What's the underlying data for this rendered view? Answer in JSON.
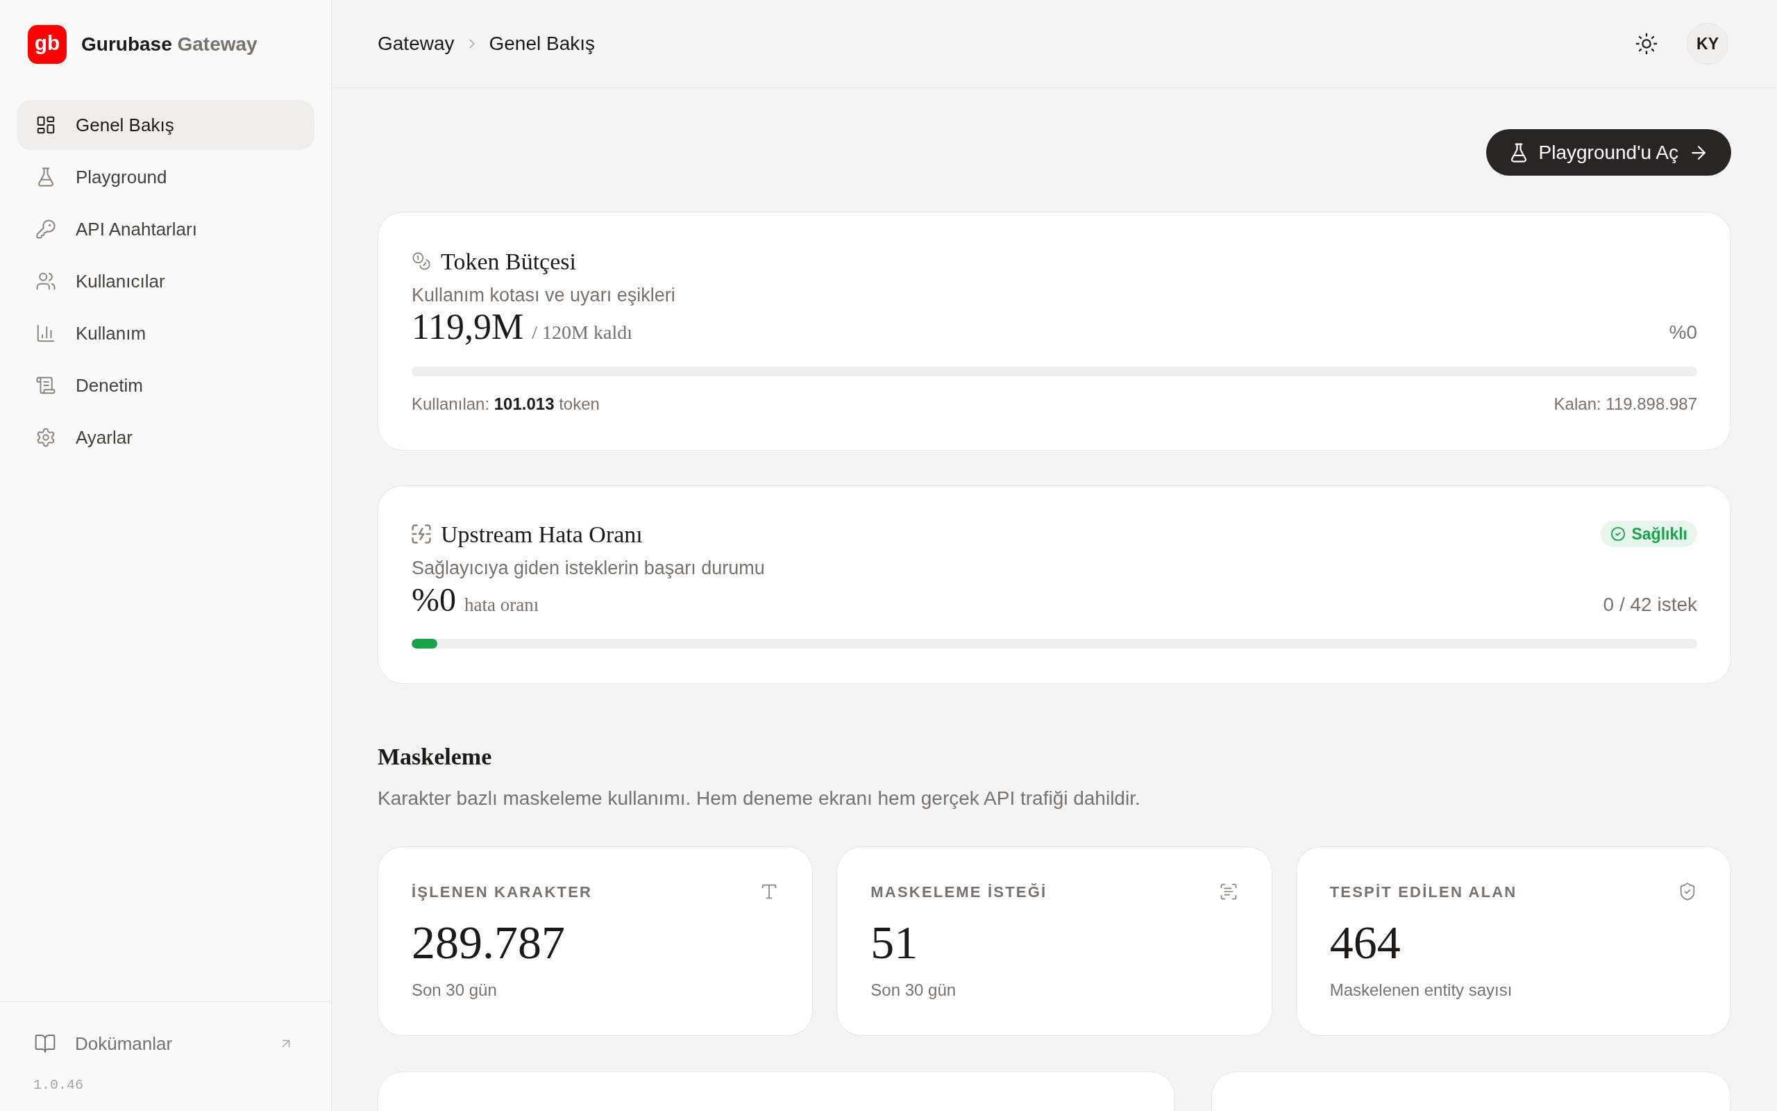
{
  "sidebar": {
    "logo": {
      "mark": "gb",
      "name": "Gurubase",
      "suffix": "Gateway"
    },
    "items": [
      {
        "label": "Genel Bakış",
        "selected": true
      },
      {
        "label": "Playground",
        "selected": false
      },
      {
        "label": "API Anahtarları",
        "selected": false
      },
      {
        "label": "Kullanıcılar",
        "selected": false
      },
      {
        "label": "Kullanım",
        "selected": false
      },
      {
        "label": "Denetim",
        "selected": false
      },
      {
        "label": "Ayarlar",
        "selected": false
      }
    ],
    "docs_link": "Dokümanlar",
    "version": "1.0.46"
  },
  "header": {
    "breadcrumb": [
      "Gateway",
      "Genel Bakış"
    ],
    "avatar": "KY"
  },
  "playground_button": "Playground'u Aç",
  "token_budget": {
    "title": "Token Bütçesi",
    "subtitle": "Kullanım kotası ve uyarı eşikleri",
    "value": "119,9M",
    "value_note": "/ 120M kaldı",
    "percent": "%0",
    "used": "Kullanılan: **101.013** token",
    "remaining": "Kalan: 119.898.987"
  },
  "upstream": {
    "title": "Upstream Hata Oranı",
    "status": {
      "label": "Sağlıklı",
      "kind": "healthy"
    },
    "subtitle": "Sağlayıcıya giden isteklerin başarı durumu",
    "value": "%0",
    "value_note": "hata oranı",
    "requests": "0 / 42 istek",
    "level": 0.02
  },
  "masking": {
    "title": "Maskeleme",
    "description": "Karakter bazlı maskeleme kullanımı. Hem deneme ekranı hem gerçek API trafiği dahildir.",
    "stats": [
      {
        "label": "İŞLENEN KARAKTER",
        "value": "289.787",
        "note": "Son 30 gün"
      },
      {
        "label": "MASKELEME İSTEĞİ",
        "value": "51",
        "note": "Son 30 gün"
      },
      {
        "label": "TESPİT EDİLEN ALAN",
        "value": "464",
        "note": "Maskelenen entity sayısı"
      }
    ]
  }
}
